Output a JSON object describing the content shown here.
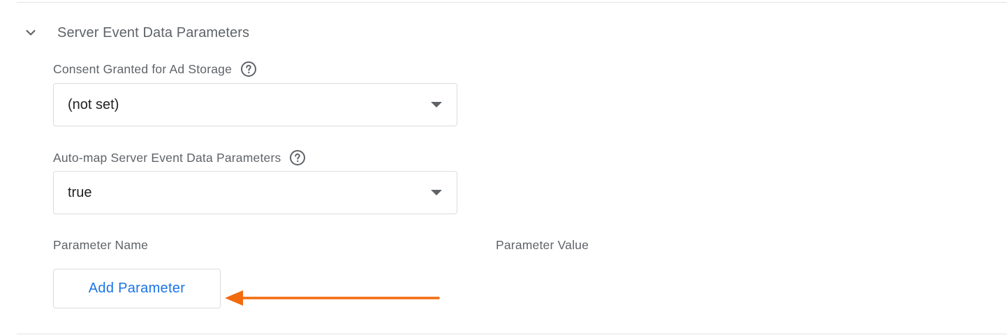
{
  "section": {
    "title": "Server Event Data Parameters",
    "expanded": true,
    "chevron_icon": "chevron-down-icon"
  },
  "consent_field": {
    "label": "Consent Granted for Ad Storage",
    "help_icon": "help-circle-icon",
    "value": "(not set)"
  },
  "automap_field": {
    "label": "Auto-map Server Event Data Parameters",
    "help_icon": "help-circle-icon",
    "value": "true"
  },
  "parameters_table": {
    "name_header": "Parameter Name",
    "value_header": "Parameter Value",
    "add_button_label": "Add Parameter"
  },
  "annotation": {
    "type": "arrow",
    "color": "#f26b0f",
    "points_to": "add-parameter-button"
  },
  "colors": {
    "accent": "#1a73e8",
    "label": "#5f6368",
    "text": "#202124",
    "border": "#dadce0"
  }
}
